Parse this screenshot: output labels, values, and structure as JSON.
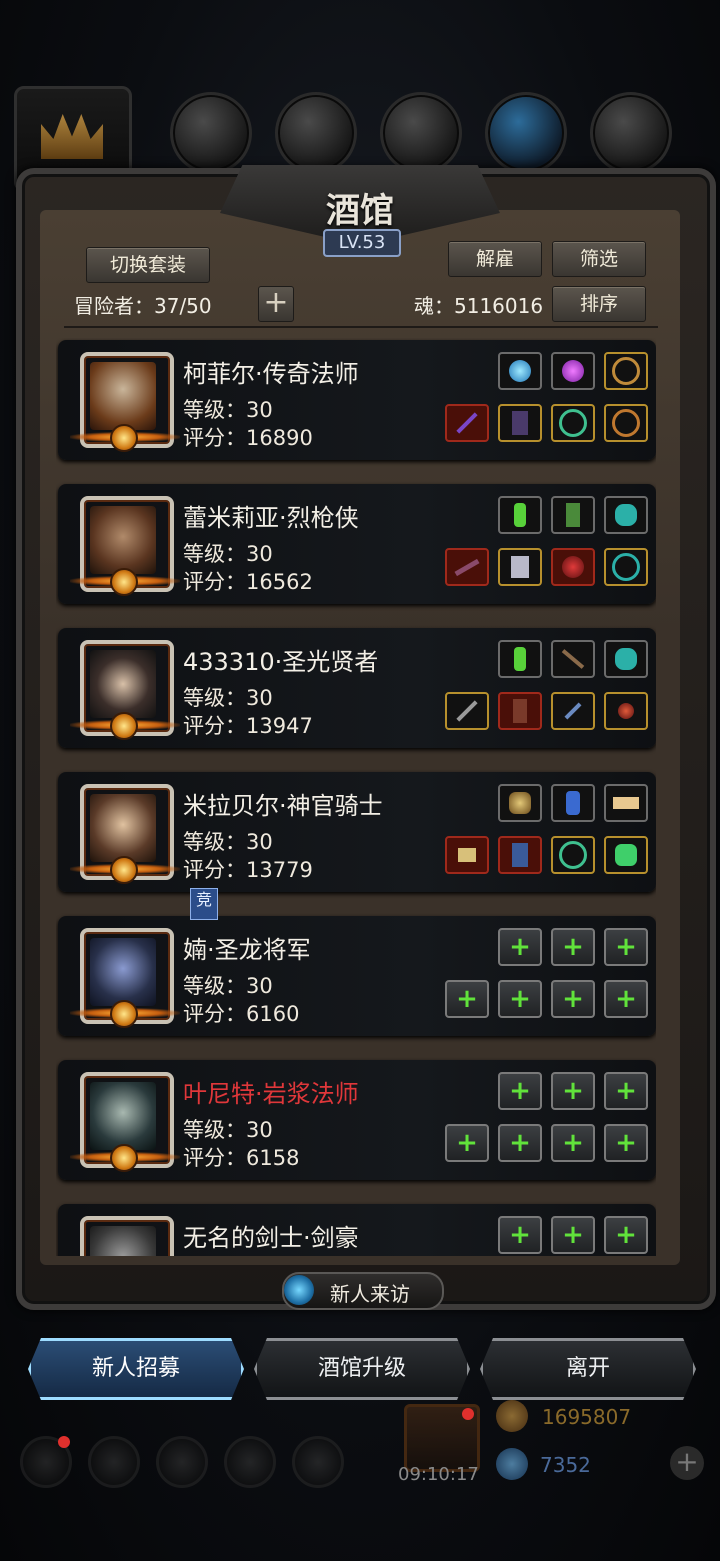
{
  "tavern": {
    "title": "酒馆",
    "level": "LV.53",
    "switch_outfit": "切换套装",
    "dismiss": "解雇",
    "filter": "筛选",
    "sort": "排序",
    "adventurers_label": "冒险者：37/50",
    "soul_label": "魂：5116016"
  },
  "heroes": [
    {
      "name": "柯菲尔·传奇法师",
      "level": "等级：30",
      "score": "评分：16890",
      "name_color": "#f3efe6",
      "portrait": "#6b3b1a"
    },
    {
      "name": "蕾米莉亚·烈枪侠",
      "level": "等级：30",
      "score": "评分：16562",
      "name_color": "#f3efe6",
      "portrait": "#5a3520"
    },
    {
      "name": "433310·圣光贤者",
      "level": "等级：30",
      "score": "评分：13947",
      "name_color": "#f3efe6",
      "portrait": "#3b2e2a"
    },
    {
      "name": "米拉贝尔·神官骑士",
      "level": "等级：30",
      "score": "评分：13779",
      "name_color": "#f3efe6",
      "portrait": "#5a3a28"
    },
    {
      "name": "婻·圣龙将军",
      "level": "等级：30",
      "score": "评分：6160",
      "name_color": "#f3efe6",
      "portrait": "#28304a"
    },
    {
      "name": "叶尼特·岩浆法师",
      "level": "等级：30",
      "score": "评分：6158",
      "name_color": "#e0373a",
      "portrait": "#2a3a3c"
    },
    {
      "name": "无名的剑士·剑豪",
      "level": "",
      "score": "",
      "name_color": "#f3efe6",
      "portrait": "#3a3a3a"
    }
  ],
  "rank_badge": "竞",
  "new_visitor": "新人来访",
  "buttons": {
    "recruit": "新人招募",
    "upgrade": "酒馆升级",
    "leave": "离开"
  },
  "footer": {
    "timer": "09:10:17",
    "gold": "1695807",
    "gems": "7352"
  },
  "colors": {
    "accent": "#9edcff",
    "empty_slot_plus": "#61e23b",
    "red_name": "#e0373a"
  }
}
